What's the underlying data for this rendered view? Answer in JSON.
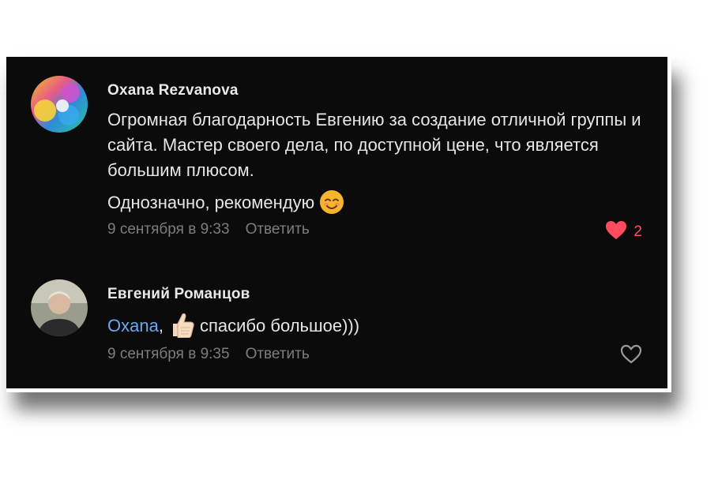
{
  "comments": [
    {
      "author": "Oxana Rezvanova",
      "paragraph1": "Огромная благодарность Евгению за создание отличной группы и сайта. Мастер своего дела, по доступной цене, что является большим плюсом.",
      "paragraph2": "Однозначно, рекомендую",
      "emoji": "smiling-face-emoji",
      "timestamp": "9 сентября в 9:33",
      "reply_label": "Ответить",
      "likes": "2",
      "liked": true
    },
    {
      "author": "Евгений Романцов",
      "mention": "Oxana",
      "mention_suffix": ",",
      "emoji": "thumbs-up-emoji",
      "text": "спасибо большое)))",
      "timestamp": "9 сентября в 9:35",
      "reply_label": "Ответить",
      "liked": false
    }
  ],
  "colors": {
    "background": "#0b0b0c",
    "text": "#e6e6e6",
    "meta": "#7d7d82",
    "like_active": "#ff4d5e",
    "mention": "#6aa9f0"
  }
}
